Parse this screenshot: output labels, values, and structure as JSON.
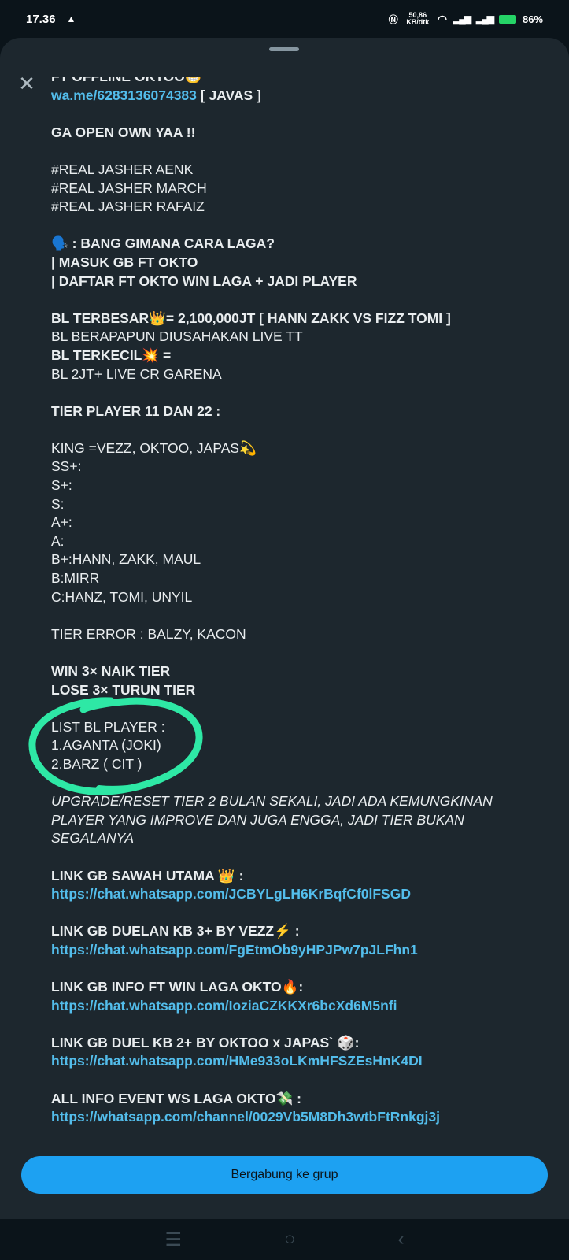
{
  "status": {
    "time": "17.36",
    "network_speed": "50,86 KB/dtk",
    "battery": "86%"
  },
  "description_lines": [
    {
      "text": "FT OFFLINE OKTOO😁",
      "style": "bold first"
    },
    {
      "text": "wa.me/6283136074383",
      "style": "link",
      "suffix": " [ JAVAS ]"
    },
    {
      "text": "",
      "style": ""
    },
    {
      "text": "GA OPEN OWN YAA !!",
      "style": "bold"
    },
    {
      "text": "",
      "style": ""
    },
    {
      "text": "#REAL JASHER AENK",
      "style": ""
    },
    {
      "text": "#REAL JASHER MARCH",
      "style": ""
    },
    {
      "text": "#REAL JASHER RAFAIZ",
      "style": ""
    },
    {
      "text": "",
      "style": ""
    },
    {
      "text": "🗣️ : BANG GIMANA CARA LAGA?",
      "style": "bold"
    },
    {
      "text": "| MASUK GB FT OKTO",
      "style": "bold"
    },
    {
      "text": "| DAFTAR FT OKTO WIN LAGA + JADI PLAYER",
      "style": "bold"
    },
    {
      "text": "",
      "style": ""
    },
    {
      "text": "BL TERBESAR👑= 2,100,000JT [ HANN ZAKK VS FIZZ TOMI ]",
      "style": "bold"
    },
    {
      "text": "BL BERAPAPUN DIUSAHAKAN LIVE TT",
      "style": ""
    },
    {
      "text": "BL TERKECIL💥 =",
      "style": "bold"
    },
    {
      "text": "BL 2JT+ LIVE CR GARENA",
      "style": ""
    },
    {
      "text": "",
      "style": ""
    },
    {
      "text": "TIER PLAYER 11 DAN 22 :",
      "style": "bold"
    },
    {
      "text": "",
      "style": ""
    },
    {
      "text": "KING =VEZZ, OKTOO, JAPAS💫",
      "style": ""
    },
    {
      "text": "SS+:",
      "style": ""
    },
    {
      "text": "S+:",
      "style": ""
    },
    {
      "text": "S:",
      "style": ""
    },
    {
      "text": "A+:",
      "style": ""
    },
    {
      "text": "A:",
      "style": ""
    },
    {
      "text": "B+:HANN, ZAKK, MAUL",
      "style": ""
    },
    {
      "text": "B:MIRR",
      "style": ""
    },
    {
      "text": "C:HANZ, TOMI, UNYIL",
      "style": ""
    },
    {
      "text": "",
      "style": ""
    },
    {
      "text": "TIER ERROR : BALZY, KACON",
      "style": ""
    },
    {
      "text": "",
      "style": ""
    },
    {
      "text": "WIN 3× NAIK TIER",
      "style": "bold"
    },
    {
      "text": "LOSE 3× TURUN TIER",
      "style": "bold"
    },
    {
      "text": "",
      "style": ""
    },
    {
      "text": "LIST BL PLAYER :",
      "style": ""
    },
    {
      "text": "1.AGANTA (JOKI)",
      "style": ""
    },
    {
      "text": "2.BARZ ( CIT )",
      "style": ""
    },
    {
      "text": "",
      "style": ""
    },
    {
      "text": "UPGRADE/RESET TIER 2 BULAN SEKALI, JADI ADA KEMUNGKINAN PLAYER YANG IMPROVE DAN JUGA ENGGA, JADI TIER BUKAN SEGALANYA",
      "style": "italic"
    },
    {
      "text": "",
      "style": ""
    },
    {
      "text": "LINK GB SAWAH UTAMA 👑 :",
      "style": "bold"
    },
    {
      "text": "https://chat.whatsapp.com/JCBYLgLH6KrBqfCf0lFSGD",
      "style": "link"
    },
    {
      "text": "",
      "style": ""
    },
    {
      "text": "LINK GB DUELAN KB 3+ BY VEZZ⚡ :",
      "style": "bold"
    },
    {
      "text": "https://chat.whatsapp.com/FgEtmOb9yHPJPw7pJLFhn1",
      "style": "link"
    },
    {
      "text": "",
      "style": ""
    },
    {
      "text": "LINK GB INFO FT WIN LAGA OKTO🔥:",
      "style": "bold"
    },
    {
      "text": "https://chat.whatsapp.com/IoziaCZKKXr6bcXd6M5nfi",
      "style": "link"
    },
    {
      "text": "",
      "style": ""
    },
    {
      "text": "LINK GB DUEL KB 2+ BY OKTOO x JAPAS` 🎲:",
      "style": "bold"
    },
    {
      "text": "https://chat.whatsapp.com/HMe933oLKmHFSZEsHnK4DI",
      "style": "link"
    },
    {
      "text": "",
      "style": ""
    },
    {
      "text": "ALL INFO EVENT WS LAGA OKTO💸 :",
      "style": "bold"
    },
    {
      "text": "https://whatsapp.com/channel/0029Vb5M8Dh3wtbFtRnkgj3j",
      "style": "link"
    }
  ],
  "join_button": {
    "label": "Bergabung ke grup"
  },
  "icons": {
    "close": "close-icon",
    "nav_menu": "menu-icon",
    "nav_home": "home-icon",
    "nav_back": "back-icon"
  },
  "colors": {
    "background": "#0b141a",
    "sheet": "#1d272e",
    "link": "#53bdeb",
    "button": "#1da1f2",
    "highlight": "#2ee8a5"
  }
}
